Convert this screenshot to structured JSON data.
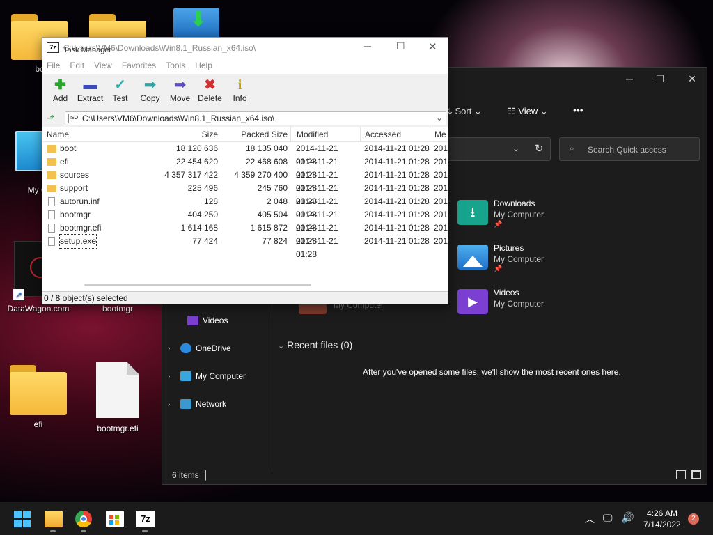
{
  "desktop": {
    "icons": [
      {
        "label": "bo"
      },
      {
        "label": "My Co"
      },
      {
        "label": "DataWagon.com"
      },
      {
        "label": "bootmgr"
      },
      {
        "label": "efi"
      },
      {
        "label": "bootmgr.efi"
      }
    ]
  },
  "explorer": {
    "toolbar": {
      "sort": "Sort",
      "view": "View",
      "more": "•••"
    },
    "search_placeholder": "Search Quick access",
    "quick_access": [
      {
        "name": "Downloads",
        "location": "My Computer",
        "color": "#18a48c"
      },
      {
        "name": "Pictures",
        "location": "My Computer",
        "color": "#2f8fe0"
      },
      {
        "name": "Videos",
        "location": "My Computer",
        "color": "#7b3fd1"
      }
    ],
    "ghost_text": "My Computer",
    "nav": [
      {
        "label": "Videos"
      },
      {
        "label": "OneDrive"
      },
      {
        "label": "My Computer"
      },
      {
        "label": "Network"
      }
    ],
    "recent_header": "Recent files (0)",
    "recent_empty": "After you've opened some files, we'll show the most recent ones here.",
    "status": "6 items"
  },
  "zip": {
    "title_overlay": "Task Manager",
    "title_path": "C:\\Users\\VM6\\Downloads\\Win8.1_Russian_x64.iso\\",
    "menu": [
      "File",
      "Edit",
      "View",
      "Favorites",
      "Tools",
      "Help"
    ],
    "tools": [
      {
        "label": "Add",
        "icon": "+",
        "color": "#2aa52a"
      },
      {
        "label": "Extract",
        "icon": "▬",
        "color": "#3b4cc0"
      },
      {
        "label": "Test",
        "icon": "✓",
        "color": "#28b0b0"
      },
      {
        "label": "Copy",
        "icon": "➡",
        "color": "#3aa0a0"
      },
      {
        "label": "Move",
        "icon": "➡",
        "color": "#5a4cc0"
      },
      {
        "label": "Delete",
        "icon": "✖",
        "color": "#d03030"
      },
      {
        "label": "Info",
        "icon": "i",
        "color": "#c0a000"
      }
    ],
    "address": "C:\\Users\\VM6\\Downloads\\Win8.1_Russian_x64.iso\\",
    "columns": {
      "name": "Name",
      "size": "Size",
      "packed": "Packed Size",
      "modified": "Modified",
      "accessed": "Accessed",
      "more": "Me"
    },
    "rows": [
      {
        "name": "boot",
        "type": "folder",
        "size": "18 120 636",
        "packed": "18 135 040",
        "modified": "2014-11-21 01:28",
        "accessed": "2014-11-21 01:28",
        "more": "201"
      },
      {
        "name": "efi",
        "type": "folder",
        "size": "22 454 620",
        "packed": "22 468 608",
        "modified": "2014-11-21 01:28",
        "accessed": "2014-11-21 01:28",
        "more": "201"
      },
      {
        "name": "sources",
        "type": "folder",
        "size": "4 357 317 422",
        "packed": "4 359 270 400",
        "modified": "2014-11-21 01:28",
        "accessed": "2014-11-21 01:28",
        "more": "201"
      },
      {
        "name": "support",
        "type": "folder",
        "size": "225 496",
        "packed": "245 760",
        "modified": "2014-11-21 01:28",
        "accessed": "2014-11-21 01:28",
        "more": "201"
      },
      {
        "name": "autorun.inf",
        "type": "file",
        "size": "128",
        "packed": "2 048",
        "modified": "2014-11-21 01:28",
        "accessed": "2014-11-21 01:28",
        "more": "201"
      },
      {
        "name": "bootmgr",
        "type": "file",
        "size": "404 250",
        "packed": "405 504",
        "modified": "2014-11-21 01:28",
        "accessed": "2014-11-21 01:28",
        "more": "201"
      },
      {
        "name": "bootmgr.efi",
        "type": "file",
        "size": "1 614 168",
        "packed": "1 615 872",
        "modified": "2014-11-21 01:28",
        "accessed": "2014-11-21 01:28",
        "more": "201"
      },
      {
        "name": "setup.exe",
        "type": "file",
        "size": "77 424",
        "packed": "77 824",
        "modified": "2014-11-21 01:28",
        "accessed": "2014-11-21 01:28",
        "more": "201"
      }
    ],
    "status": "0 / 8 object(s) selected"
  },
  "taskbar": {
    "time": "4:26 AM",
    "date": "7/14/2022",
    "notifications": "2",
    "sevenzip_label": "7z"
  }
}
